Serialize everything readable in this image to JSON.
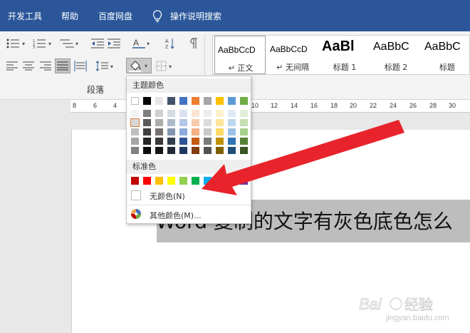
{
  "tabs": {
    "devtools": "开发工具",
    "help": "帮助",
    "baidu_disk": "百度网盘",
    "tell_me": "操作说明搜索"
  },
  "ribbon": {
    "paragraph_group": "段落"
  },
  "styles": [
    {
      "sample": "AaBbCcD",
      "name": "↵ 正文"
    },
    {
      "sample": "AaBbCcD",
      "name": "↵ 无间隔"
    },
    {
      "sample": "AaBl",
      "name": "标题 1"
    },
    {
      "sample": "AaBbC",
      "name": "标题 2"
    },
    {
      "sample": "AaBbC",
      "name": "标题"
    }
  ],
  "ruler": [
    "8",
    "6",
    "4",
    "10",
    "12",
    "14",
    "16",
    "18",
    "20",
    "22",
    "24",
    "26",
    "28",
    "30",
    "32"
  ],
  "document": {
    "text": "Word 复制的文字有灰色底色怎么"
  },
  "color_menu": {
    "theme_header": "主题颜色",
    "standard_header": "标准色",
    "no_color": "无颜色(N)",
    "more_colors": "其他颜色(M)...",
    "theme_row": [
      "#ffffff",
      "#000000",
      "#e7e6e6",
      "#44546a",
      "#4472c4",
      "#ed7d31",
      "#a5a5a5",
      "#ffc000",
      "#5b9bd5",
      "#70ad47"
    ],
    "theme_shades": [
      [
        "#f2f2f2",
        "#7f7f7f",
        "#d0cece",
        "#d6dce4",
        "#d9e2f3",
        "#fbe5d5",
        "#ededed",
        "#fff2cc",
        "#deebf6",
        "#e2efd9"
      ],
      [
        "#d8d8d8",
        "#595959",
        "#aeabab",
        "#adb9ca",
        "#b4c6e7",
        "#f7cbac",
        "#dbdbdb",
        "#fee599",
        "#bdd7ee",
        "#c5e0b3"
      ],
      [
        "#bfbfbf",
        "#3f3f3f",
        "#757070",
        "#8496b0",
        "#8eaadb",
        "#f4b183",
        "#c9c9c9",
        "#ffd965",
        "#9cc3e5",
        "#a8d08d"
      ],
      [
        "#a5a5a5",
        "#262626",
        "#3a3838",
        "#323f4f",
        "#2f5496",
        "#c55a11",
        "#7b7b7b",
        "#bf9000",
        "#2e75b5",
        "#538135"
      ],
      [
        "#7f7f7f",
        "#0c0c0c",
        "#171616",
        "#222a35",
        "#1f3763",
        "#833c0b",
        "#525252",
        "#7f6000",
        "#1e4e79",
        "#375623"
      ]
    ],
    "standard_row": [
      "#c00000",
      "#ff0000",
      "#ffc000",
      "#ffff00",
      "#92d050",
      "#00b050",
      "#00b0f0",
      "#0070c0",
      "#002060",
      "#7030a0"
    ],
    "arrow_color": "#e8232b"
  },
  "watermark": {
    "site": "jingyan.baidu.com"
  }
}
